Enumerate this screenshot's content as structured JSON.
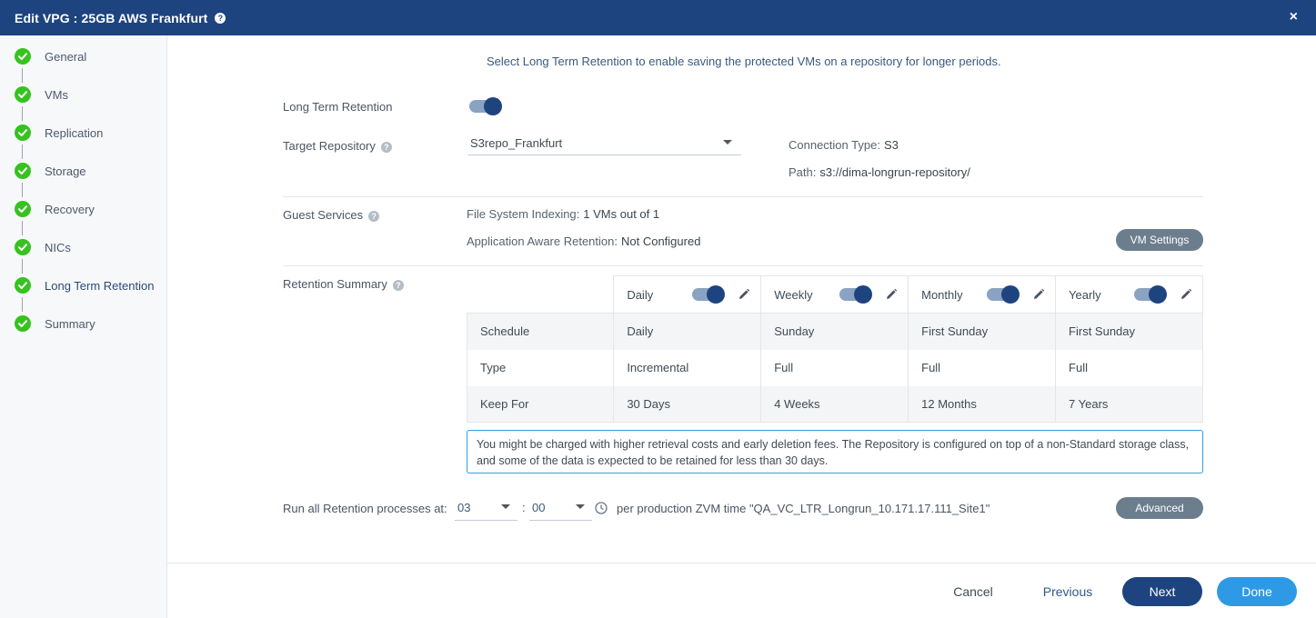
{
  "header": {
    "title": "Edit VPG : 25GB AWS Frankfurt",
    "help": "?",
    "close": "×"
  },
  "sidebar": {
    "steps": [
      {
        "label": "General"
      },
      {
        "label": "VMs"
      },
      {
        "label": "Replication"
      },
      {
        "label": "Storage"
      },
      {
        "label": "Recovery"
      },
      {
        "label": "NICs"
      },
      {
        "label": "Long Term Retention"
      },
      {
        "label": "Summary"
      }
    ]
  },
  "main": {
    "intro": "Select Long Term Retention to enable saving the protected VMs on a repository for longer periods.",
    "ltr": {
      "label": "Long Term Retention",
      "enabled": true
    },
    "target_repo": {
      "label": "Target Repository",
      "value": "S3repo_Frankfurt",
      "connection_type_label": "Connection Type:",
      "connection_type": "S3",
      "path_label": "Path:",
      "path": "s3://dima-longrun-repository/"
    },
    "guest_services": {
      "label": "Guest Services",
      "fs_indexing_label": "File System Indexing:",
      "fs_indexing": "1 VMs out of 1",
      "aar_label": "Application Aware Retention:",
      "aar": "Not Configured",
      "vm_settings": "VM Settings"
    },
    "retention": {
      "label": "Retention Summary",
      "columns": [
        {
          "name": "Daily",
          "enabled": true
        },
        {
          "name": "Weekly",
          "enabled": true
        },
        {
          "name": "Monthly",
          "enabled": true
        },
        {
          "name": "Yearly",
          "enabled": true
        }
      ],
      "rows": [
        {
          "label": "Schedule",
          "values": [
            "Daily",
            "Sunday",
            "First Sunday",
            "First Sunday"
          ]
        },
        {
          "label": "Type",
          "values": [
            "Incremental",
            "Full",
            "Full",
            "Full"
          ]
        },
        {
          "label": "Keep For",
          "values": [
            "30 Days",
            "4 Weeks",
            "12 Months",
            "7 Years"
          ]
        }
      ],
      "notice": "You might be charged with higher retrieval costs and early deletion fees. The Repository is configured on top of a non-Standard storage class, and some of the data is expected to be retained for less than 30 days."
    },
    "run_time": {
      "label": "Run all Retention processes at:",
      "hour": "03",
      "separator": ":",
      "minute": "00",
      "note": "per production ZVM time \"QA_VC_LTR_Longrun_10.171.17.111_Site1\"",
      "advanced": "Advanced"
    }
  },
  "footer": {
    "cancel": "Cancel",
    "previous": "Previous",
    "next": "Next",
    "done": "Done"
  },
  "colors": {
    "header": "#1e447f",
    "check": "#36c21f",
    "next": "#1e447f",
    "done": "#2e9ae6",
    "notice_border": "#2ea0e0"
  }
}
